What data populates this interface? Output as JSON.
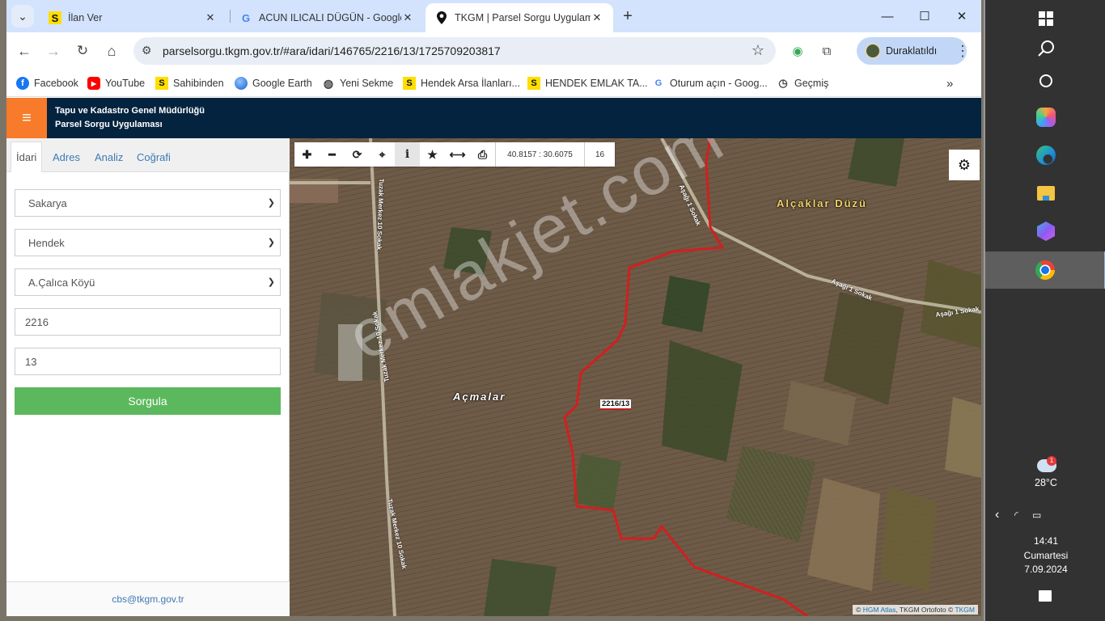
{
  "browser": {
    "tabs": [
      {
        "label": "İlan Ver",
        "favicon": "sahibinden-s-icon",
        "active": false
      },
      {
        "label": "ACUN ILICALI DÜGÜN - Google",
        "favicon": "google-g-icon",
        "active": false
      },
      {
        "label": "TKGM | Parsel Sorgu Uygulaması",
        "favicon": "map-pin-icon",
        "active": true
      }
    ],
    "new_tab": "+",
    "url": "parselsorgu.tkgm.gov.tr/#ara/idari/146765/2216/13/1725709203817",
    "profile_label": "Duraklatıldı",
    "bookmarks": [
      {
        "label": "Facebook",
        "icon": "facebook-icon"
      },
      {
        "label": "YouTube",
        "icon": "youtube-icon"
      },
      {
        "label": "Sahibinden",
        "icon": "sahibinden-s-icon"
      },
      {
        "label": "Google Earth",
        "icon": "google-earth-icon"
      },
      {
        "label": "Yeni Sekme",
        "icon": "globe-icon"
      },
      {
        "label": "Hendek Arsa İlanları...",
        "icon": "sahibinden-s-icon"
      },
      {
        "label": "HENDEK EMLAK TA...",
        "icon": "sahibinden-s-icon"
      },
      {
        "label": "Oturum açın - Goog...",
        "icon": "google-g-icon"
      },
      {
        "label": "Geçmiş",
        "icon": "history-icon"
      }
    ],
    "more_bookmarks": "»"
  },
  "app": {
    "title_line1": "Tapu ve Kadastro Genel Müdürlüğü",
    "title_line2": "Parsel Sorgu Uygulaması",
    "accent_color": "#f77b2a",
    "header_color": "#04233f"
  },
  "sidebar": {
    "tabs": [
      {
        "label": "İdari",
        "active": true
      },
      {
        "label": "Adres",
        "active": false
      },
      {
        "label": "Analiz",
        "active": false
      },
      {
        "label": "Coğrafi",
        "active": false
      }
    ],
    "province": "Sakarya",
    "district": "Hendek",
    "neighborhood": "A.Çalıca Köyü",
    "block": "2216",
    "parcel": "13",
    "submit_label": "Sorgula",
    "submit_color": "#5cb85c",
    "footer_email": "cbs@tkgm.gov.tr"
  },
  "map": {
    "coordinates": "40.8157 : 30.6075",
    "zoom_level": "16",
    "labels": {
      "area_1": "Alçaklar Düzü",
      "area_2": "Açmalar",
      "parcel": "2216/13",
      "street_1": "Aşağı 1 Sokak",
      "street_2": "Aşağı 1 Sokak",
      "street_3": "Aşağı 1 Sokak",
      "street_4": "Tuzak Merkez 10 Sokak",
      "street_5": "Tuzak Merkez 10 Sokak",
      "street_6": "Tuzak Merkez 10 Sokak"
    },
    "watermark": "emlakjet.com",
    "attribution": {
      "prefix": "© ",
      "link1": "HGM Atlas",
      "middle": ", TKGM Ortofoto © ",
      "link2": "TKGM"
    },
    "boundary_color": "#d21f1f"
  },
  "taskbar": {
    "weather_temp": "28°C",
    "weather_badge": "1",
    "time": "14:41",
    "day": "Cumartesi",
    "date": "7.09.2024"
  }
}
